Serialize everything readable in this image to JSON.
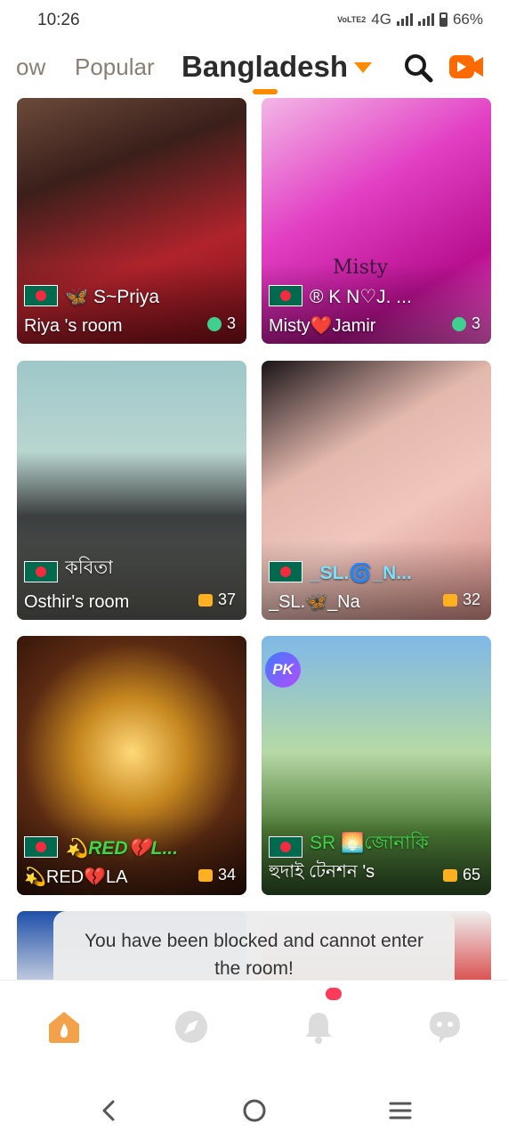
{
  "status_bar": {
    "time": "10:26",
    "volte_label": "VoLTE2",
    "network": "4G",
    "battery": "66%"
  },
  "top_nav": {
    "tabs": [
      {
        "label": "ow"
      },
      {
        "label": "Popular"
      },
      {
        "label": "Bangladesh",
        "active": true
      }
    ],
    "accent_color": "#ff8a00",
    "icons": [
      "search-icon",
      "go-live-icon"
    ]
  },
  "rooms": [
    {
      "host": "🦋 S~Priya",
      "room": "Riya 's room",
      "count": "3",
      "count_type": "viewers"
    },
    {
      "host": "® K N♡J. ...",
      "room": "Misty❤️Jamir",
      "count": "3",
      "count_type": "viewers",
      "overlay_text": "Misty"
    },
    {
      "host": "কবিতা",
      "room": "Osthir's room",
      "count": "37",
      "count_type": "video"
    },
    {
      "host": "_SL.🌀_N...",
      "room": "_SL.🦋_Na",
      "count": "32",
      "count_type": "video"
    },
    {
      "host": "💫RED💔L...",
      "room": "💫RED💔LA",
      "count": "34",
      "count_type": "video"
    },
    {
      "host": "SR 🌅জোনাকি",
      "room": "হুদাই টেনশন 's",
      "count": "65",
      "count_type": "video",
      "badge": "PK"
    }
  ],
  "toast": {
    "message": "You have been blocked and cannot enter the room!"
  },
  "bottom_nav": {
    "items": [
      "home-icon",
      "explore-icon",
      "bell-icon",
      "chat-icon"
    ],
    "active": "home-icon"
  },
  "system_nav": [
    "back-icon",
    "home-circle-icon",
    "recent-apps-icon"
  ]
}
